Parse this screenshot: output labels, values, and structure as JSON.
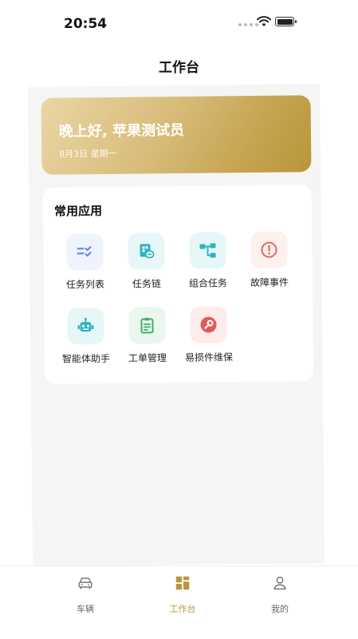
{
  "status_bar": {
    "time": "20:54"
  },
  "header": {
    "title": "工作台"
  },
  "greeting": {
    "text": "晚上好, 苹果测试员",
    "date": "8月3日 星期一"
  },
  "apps": {
    "title": "常用应用",
    "items": [
      {
        "label": "任务列表",
        "icon": "checklist-icon",
        "bg": "#eef3fd",
        "color": "#5b7ee6"
      },
      {
        "label": "任务链",
        "icon": "task-link-icon",
        "bg": "#e7f7f8",
        "color": "#2fb3c2"
      },
      {
        "label": "组合任务",
        "icon": "flow-icon",
        "bg": "#e7f7f8",
        "color": "#2fb3c2"
      },
      {
        "label": "故障事件",
        "icon": "alert-icon",
        "bg": "#fdf0ee",
        "color": "#e06b5f"
      },
      {
        "label": "智能体助手",
        "icon": "robot-icon",
        "bg": "#e7f7f8",
        "color": "#2fb3c2"
      },
      {
        "label": "工单管理",
        "icon": "clipboard-icon",
        "bg": "#eaf6ee",
        "color": "#3db36a"
      },
      {
        "label": "易损件维保",
        "icon": "wrench-icon",
        "bg": "#fdeceb",
        "color": "#e05c57"
      }
    ]
  },
  "tabbar": {
    "items": [
      {
        "label": "车辆",
        "icon": "car-icon"
      },
      {
        "label": "工作台",
        "icon": "workbench-icon",
        "active": true
      },
      {
        "label": "我的",
        "icon": "user-icon"
      }
    ],
    "active_color": "#b8963a"
  }
}
